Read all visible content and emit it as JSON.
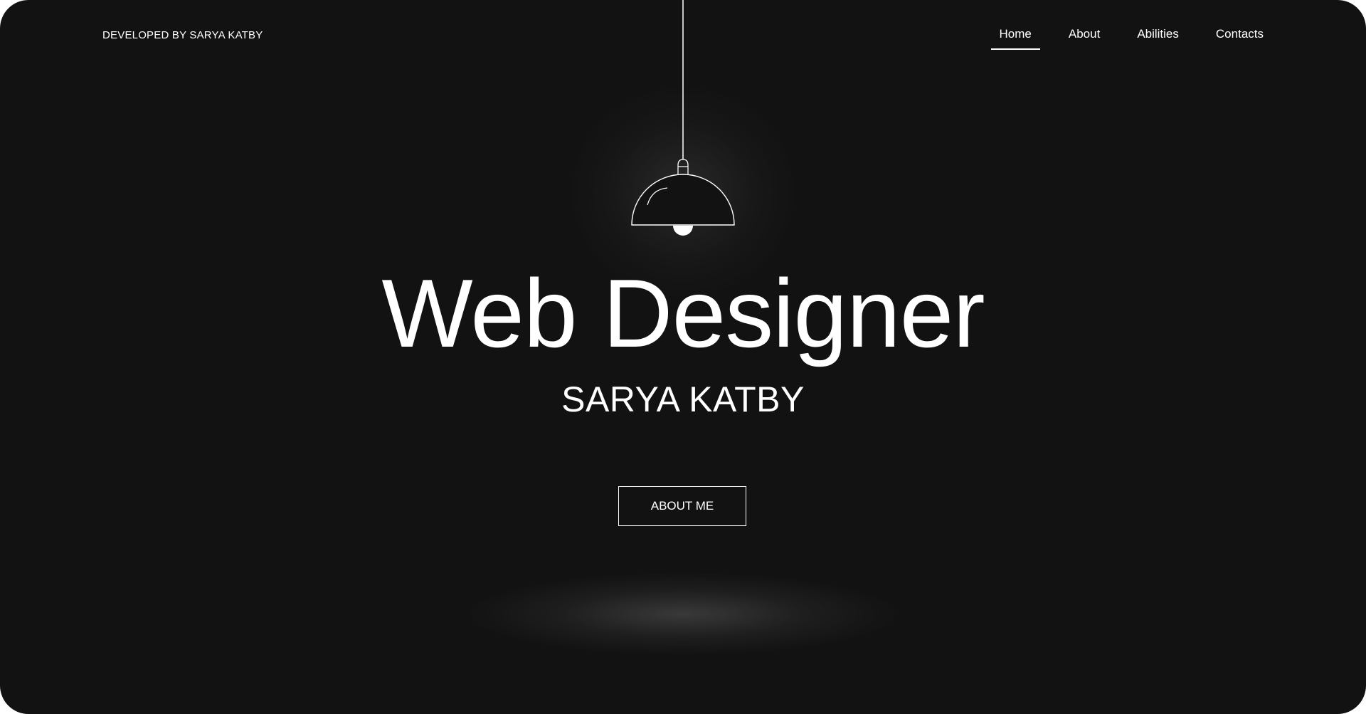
{
  "header": {
    "credit": "DEVELOPED BY SARYA KATBY"
  },
  "nav": {
    "items": [
      {
        "label": "Home",
        "active": true
      },
      {
        "label": "About",
        "active": false
      },
      {
        "label": "Abilities",
        "active": false
      },
      {
        "label": "Contacts",
        "active": false
      }
    ]
  },
  "hero": {
    "headline": "Web Designer",
    "subtitle": "SARYA KATBY",
    "cta_label": "ABOUT ME"
  },
  "icons": {
    "lamp": "pendant-lamp-icon"
  },
  "colors": {
    "background": "#121212",
    "foreground": "#ffffff"
  }
}
